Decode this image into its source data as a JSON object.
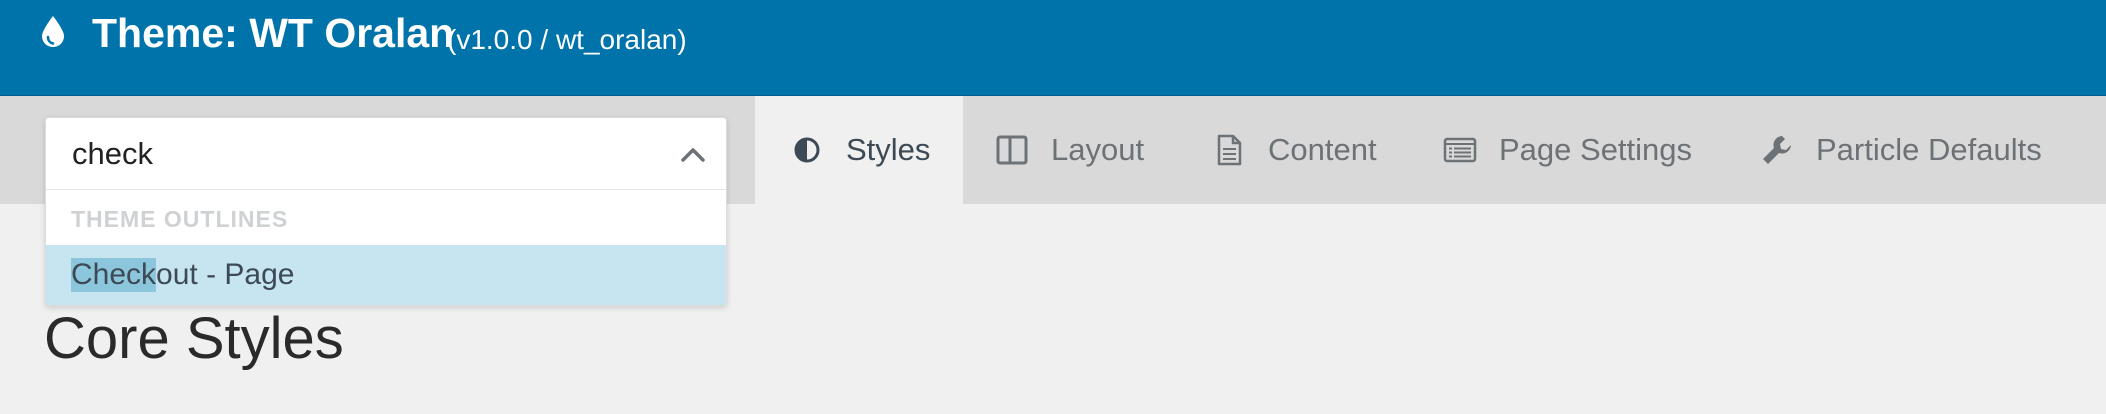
{
  "header": {
    "icon": "drop-icon",
    "title": "Theme: WT Oralan",
    "version": "(v1.0.0 / wt_oralan)"
  },
  "outline_select": {
    "query": "check",
    "group_label": "THEME OUTLINES",
    "options": [
      {
        "match": "Check",
        "rest": "out - Page"
      }
    ]
  },
  "tabs": [
    {
      "label": "Styles",
      "icon": "half-circle-icon",
      "active": true
    },
    {
      "label": "Layout",
      "icon": "columns-icon"
    },
    {
      "label": "Content",
      "icon": "file-text-icon"
    },
    {
      "label": "Page Settings",
      "icon": "list-panel-icon"
    },
    {
      "label": "Particle Defaults",
      "icon": "wrench-icon"
    }
  ],
  "main": {
    "title": "Core Styles"
  },
  "colors": {
    "header_bg": "#0073aa",
    "nav_bg": "#d9d9d9",
    "active_tab_bg": "#f0f0f0",
    "option_highlight": "#c6e5f1",
    "match_highlight": "#8cc6dc"
  }
}
